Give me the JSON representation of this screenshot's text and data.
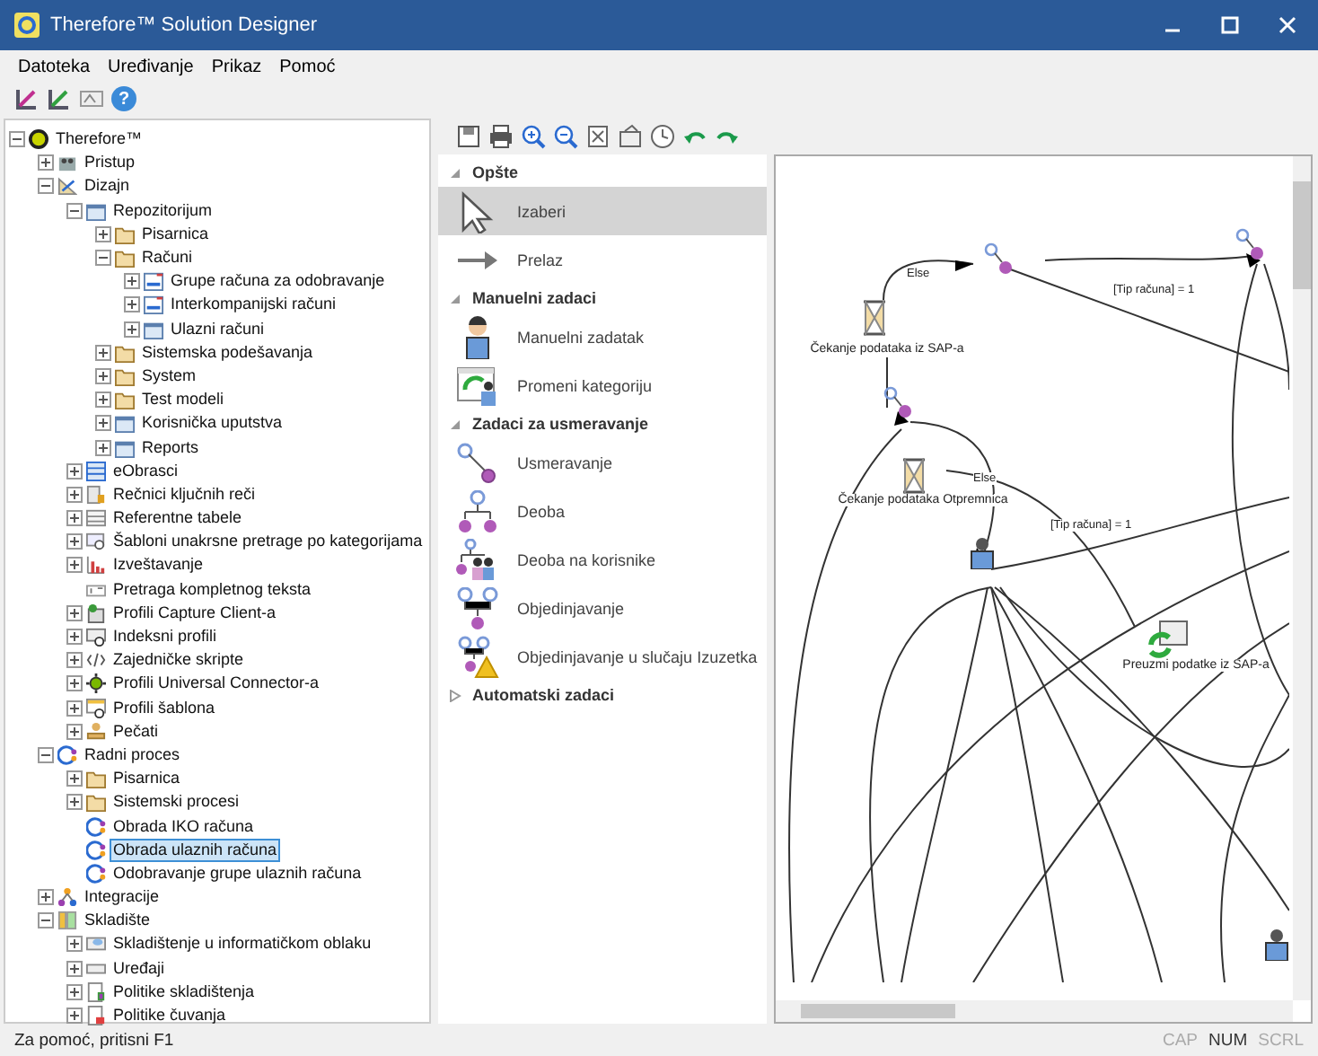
{
  "window": {
    "title": "Therefore™ Solution Designer"
  },
  "menu": [
    "Datoteka",
    "Uređivanje",
    "Prikaz",
    "Pomoć"
  ],
  "toolbar": {
    "help_glyph": "?"
  },
  "tree": [
    {
      "label": "Therefore™",
      "expanded": true,
      "selected": false,
      "children": [
        {
          "label": "Pristup",
          "expanded": false,
          "selected": false
        },
        {
          "label": "Dizajn",
          "expanded": true,
          "selected": false,
          "children": [
            {
              "label": "Repozitorijum",
              "expanded": true,
              "selected": false,
              "children": [
                {
                  "label": "Pisarnica",
                  "expanded": false,
                  "selected": false
                },
                {
                  "label": "Računi",
                  "expanded": true,
                  "selected": false,
                  "children": [
                    {
                      "label": "Grupe računa za odobravanje",
                      "expanded": false,
                      "selected": false
                    },
                    {
                      "label": "Interkompanijski računi",
                      "expanded": false,
                      "selected": false
                    },
                    {
                      "label": "Ulazni računi",
                      "expanded": false,
                      "selected": false
                    }
                  ]
                },
                {
                  "label": "Sistemska podešavanja",
                  "expanded": false,
                  "selected": false
                },
                {
                  "label": "System",
                  "expanded": false,
                  "selected": false
                },
                {
                  "label": "Test modeli",
                  "expanded": false,
                  "selected": false
                },
                {
                  "label": "Korisnička uputstva",
                  "expanded": false,
                  "selected": false
                },
                {
                  "label": "Reports",
                  "expanded": false,
                  "selected": false
                }
              ]
            },
            {
              "label": "eObrasci",
              "expanded": false,
              "selected": false
            },
            {
              "label": "Rečnici ključnih reči",
              "expanded": false,
              "selected": false
            },
            {
              "label": "Referentne tabele",
              "expanded": false,
              "selected": false
            },
            {
              "label": "Šabloni unakrsne pretrage po kategorijama",
              "expanded": false,
              "selected": false
            },
            {
              "label": "Izveštavanje",
              "expanded": false,
              "selected": false
            },
            {
              "label": "Pretraga kompletnog teksta",
              "selected": false
            },
            {
              "label": "Profili Capture Client-a",
              "expanded": false,
              "selected": false
            },
            {
              "label": "Indeksni profili",
              "expanded": false,
              "selected": false
            },
            {
              "label": "Zajedničke skripte",
              "expanded": false,
              "selected": false
            },
            {
              "label": "Profili Universal Connector-a",
              "expanded": false,
              "selected": false
            },
            {
              "label": "Profili šablona",
              "expanded": false,
              "selected": false
            },
            {
              "label": "Pečati",
              "expanded": false,
              "selected": false
            }
          ]
        },
        {
          "label": "Radni proces",
          "expanded": true,
          "selected": false,
          "children": [
            {
              "label": "Pisarnica",
              "expanded": false,
              "selected": false
            },
            {
              "label": "Sistemski procesi",
              "expanded": false,
              "selected": false
            },
            {
              "label": "Obrada IKO računa",
              "selected": false
            },
            {
              "label": "Obrada ulaznih računa",
              "selected": true
            },
            {
              "label": "Odobravanje grupe ulaznih računa",
              "selected": false
            }
          ]
        },
        {
          "label": "Integracije",
          "expanded": false,
          "selected": false
        },
        {
          "label": "Skladište",
          "expanded": true,
          "selected": false,
          "children": [
            {
              "label": "Skladištenje u informatičkom oblaku",
              "expanded": false,
              "selected": false
            },
            {
              "label": "Uređaji",
              "expanded": false,
              "selected": false
            },
            {
              "label": "Politike skladištenja",
              "expanded": false,
              "selected": false
            },
            {
              "label": "Politike čuvanja",
              "expanded": false,
              "selected": false
            }
          ]
        }
      ]
    }
  ],
  "palette": [
    {
      "title": "Opšte",
      "expanded": true,
      "items": [
        {
          "label": "Izaberi",
          "selected": true
        },
        {
          "label": "Prelaz",
          "selected": false
        }
      ]
    },
    {
      "title": "Manuelni zadaci",
      "expanded": true,
      "items": [
        {
          "label": "Manuelni zadatak",
          "selected": false
        },
        {
          "label": "Promeni kategoriju",
          "selected": false
        }
      ]
    },
    {
      "title": "Zadaci za usmeravanje",
      "expanded": true,
      "items": [
        {
          "label": "Usmeravanje",
          "selected": false
        },
        {
          "label": "Deoba",
          "selected": false
        },
        {
          "label": "Deoba na korisnike",
          "selected": false
        },
        {
          "label": "Objedinjavanje",
          "selected": false
        },
        {
          "label": "Objedinjavanje u slučaju Izuzetka",
          "selected": false
        }
      ]
    },
    {
      "title": "Automatski zadaci",
      "expanded": false
    }
  ],
  "canvas": {
    "nodes": [
      {
        "label": "Čekanje podataka iz SAP-a",
        "kind": "wait"
      },
      {
        "label": "Čekanje podataka Otpremnica",
        "kind": "wait"
      },
      {
        "label": "Preuzmi podatke iz SAP-a",
        "kind": "task"
      }
    ],
    "edge_labels": [
      "Else",
      "[Tip računa] = 1",
      "Else",
      "[Tip računa] = 1"
    ]
  },
  "status_bar": {
    "text": "Za pomoć, pritisni F1",
    "indicators": [
      {
        "label": "CAP",
        "on": false
      },
      {
        "label": "NUM",
        "on": true
      },
      {
        "label": "SCRL",
        "on": false
      }
    ]
  }
}
